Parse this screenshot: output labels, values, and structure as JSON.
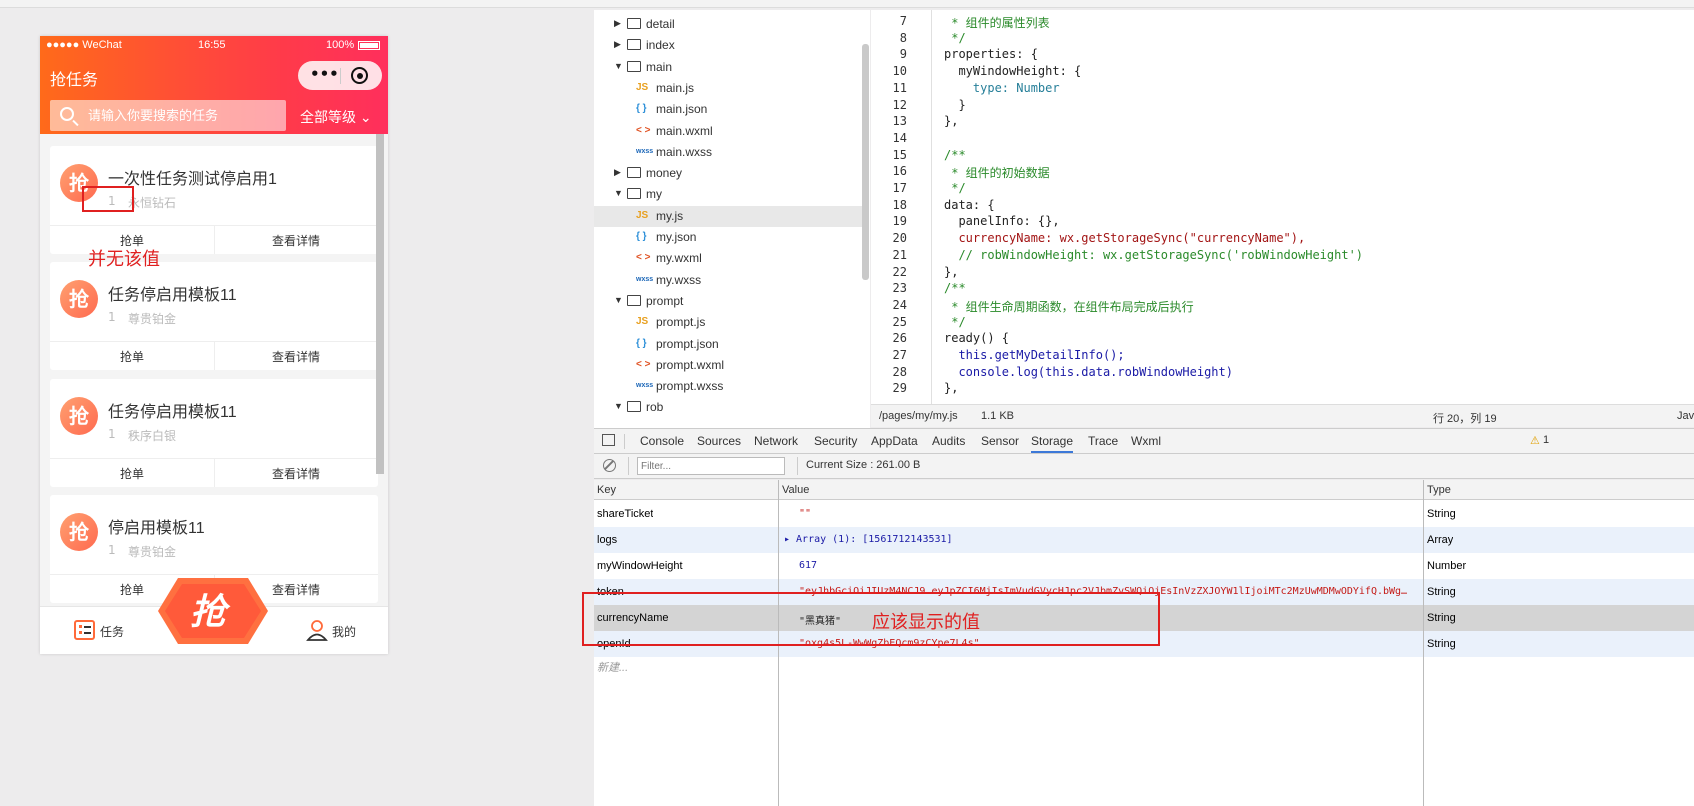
{
  "simulator": {
    "status": {
      "carrier": "●●●●● WeChat",
      "time": "16:55",
      "battery": "100%"
    },
    "title": "抢任务",
    "capsule_dots": "•••",
    "search": {
      "placeholder": "请输入你要搜索的任务"
    },
    "level_select": "全部等级",
    "cards": [
      {
        "logo": "抢",
        "name": "一次性任务测试停启用1",
        "level_num": "1",
        "level_name": "永恒钻石",
        "grab": "抢单",
        "detail": "查看详情"
      },
      {
        "logo": "抢",
        "name": "任务停启用模板11",
        "level_num": "1",
        "level_name": "尊贵铂金",
        "grab": "抢单",
        "detail": "查看详情"
      },
      {
        "logo": "抢",
        "name": "任务停启用模板11",
        "level_num": "1",
        "level_name": "秩序白银",
        "grab": "抢单",
        "detail": "查看详情"
      },
      {
        "logo": "抢",
        "name": "停启用模板11",
        "level_num": "1",
        "level_name": "尊贵铂金",
        "grab": "抢单",
        "detail": "查看详情"
      }
    ],
    "tabbar": {
      "task": "任务",
      "grab": "抢",
      "me": "我的"
    }
  },
  "annotations": {
    "no_value": "并无该值",
    "should_show": "应该显示的值"
  },
  "filetree": {
    "rows": [
      {
        "type": "folder",
        "open": false,
        "indent": 0,
        "label": "detail"
      },
      {
        "type": "folder",
        "open": false,
        "indent": 0,
        "label": "index"
      },
      {
        "type": "folder",
        "open": true,
        "indent": 0,
        "label": "main"
      },
      {
        "type": "js",
        "indent": 1,
        "label": "main.js"
      },
      {
        "type": "json",
        "indent": 1,
        "label": "main.json"
      },
      {
        "type": "wxml",
        "indent": 1,
        "label": "main.wxml"
      },
      {
        "type": "wxss",
        "indent": 1,
        "label": "main.wxss"
      },
      {
        "type": "folder",
        "open": false,
        "indent": 0,
        "label": "money"
      },
      {
        "type": "folder",
        "open": true,
        "indent": 0,
        "label": "my"
      },
      {
        "type": "js",
        "indent": 1,
        "label": "my.js",
        "selected": true
      },
      {
        "type": "json",
        "indent": 1,
        "label": "my.json"
      },
      {
        "type": "wxml",
        "indent": 1,
        "label": "my.wxml"
      },
      {
        "type": "wxss",
        "indent": 1,
        "label": "my.wxss"
      },
      {
        "type": "folder",
        "open": true,
        "indent": 0,
        "label": "prompt"
      },
      {
        "type": "js",
        "indent": 1,
        "label": "prompt.js"
      },
      {
        "type": "json",
        "indent": 1,
        "label": "prompt.json"
      },
      {
        "type": "wxml",
        "indent": 1,
        "label": "prompt.wxml"
      },
      {
        "type": "wxss",
        "indent": 1,
        "label": "prompt.wxss"
      },
      {
        "type": "folder",
        "open": true,
        "indent": 0,
        "label": "rob"
      }
    ],
    "icons": {
      "js": "JS",
      "json": "{ }",
      "wxml": "< >",
      "wxss": "wxss"
    }
  },
  "editor": {
    "lines": [
      {
        "n": "7",
        "t": " * 组件的属性列表",
        "c": "cm"
      },
      {
        "n": "8",
        "t": " */",
        "c": "cm"
      },
      {
        "n": "9",
        "t": "properties: {",
        "c": ""
      },
      {
        "n": "10",
        "t": "  myWindowHeight: {",
        "c": ""
      },
      {
        "n": "11",
        "t": "    type: Number",
        "c": "ty"
      },
      {
        "n": "12",
        "t": "  }",
        "c": ""
      },
      {
        "n": "13",
        "t": "},",
        "c": ""
      },
      {
        "n": "14",
        "t": "",
        "c": ""
      },
      {
        "n": "15",
        "t": "/**",
        "c": "cm"
      },
      {
        "n": "16",
        "t": " * 组件的初始数据",
        "c": "cm"
      },
      {
        "n": "17",
        "t": " */",
        "c": "cm"
      },
      {
        "n": "18",
        "t": "data: {",
        "c": ""
      },
      {
        "n": "19",
        "t": "  panelInfo: {},",
        "c": ""
      },
      {
        "n": "20",
        "t": "  currencyName: wx.getStorageSync(\"currencyName\"),",
        "c": "str"
      },
      {
        "n": "21",
        "t": "  // robWindowHeight: wx.getStorageSync('robWindowHeight')",
        "c": "cm"
      },
      {
        "n": "22",
        "t": "},",
        "c": ""
      },
      {
        "n": "23",
        "t": "/**",
        "c": "cm"
      },
      {
        "n": "24",
        "t": " * 组件生命周期函数，在组件布局完成后执行",
        "c": "cm"
      },
      {
        "n": "25",
        "t": " */",
        "c": "cm"
      },
      {
        "n": "26",
        "t": "ready() {",
        "c": ""
      },
      {
        "n": "27",
        "t": "  this.getMyDetailInfo();",
        "c": "kw"
      },
      {
        "n": "28",
        "t": "  console.log(this.data.robWindowHeight)",
        "c": "kw"
      },
      {
        "n": "29",
        "t": "},",
        "c": ""
      }
    ],
    "status": {
      "path": "/pages/my/my.js",
      "size": "1.1 KB",
      "cursor": "行 20，列 19",
      "lang": "Jav"
    }
  },
  "devtools": {
    "tabs": [
      "Console",
      "Sources",
      "Network",
      "Security",
      "AppData",
      "Audits",
      "Sensor",
      "Storage",
      "Trace",
      "Wxml"
    ],
    "active_tab": "Storage",
    "warning_count": "1",
    "filter_placeholder": "Filter...",
    "current_size": "Current Size : 261.00 B",
    "columns": {
      "key": "Key",
      "value": "Value",
      "type": "Type"
    },
    "rows": [
      {
        "key": "shareTicket",
        "value": "\"\"",
        "type": "String"
      },
      {
        "key": "logs",
        "value": "▸ Array (1): [1561712143531]",
        "type": "Array"
      },
      {
        "key": "myWindowHeight",
        "value": "617",
        "type": "Number"
      },
      {
        "key": "token",
        "value": "\"eyJhbGciOiJIUzM4NCJ9.eyJpZCI6MjIsImVudGVycHJpc2VJbmZvSWQiOjEsInVzZXJOYW1lIjoiMTc2MzUwMDMwODYifQ.bWg…",
        "type": "String"
      },
      {
        "key": "currencyName",
        "value": "\"黑真猪\"",
        "type": "String"
      },
      {
        "key": "openId",
        "value": "\"oxg4s5L-WwWgZbEQcm9zCYpe7L4s\"",
        "type": "String"
      }
    ],
    "new_row": "新建..."
  },
  "colors": {
    "accent": "#ff5a2a",
    "annotation": "#e02020",
    "tab_active": "#3c78d8"
  }
}
